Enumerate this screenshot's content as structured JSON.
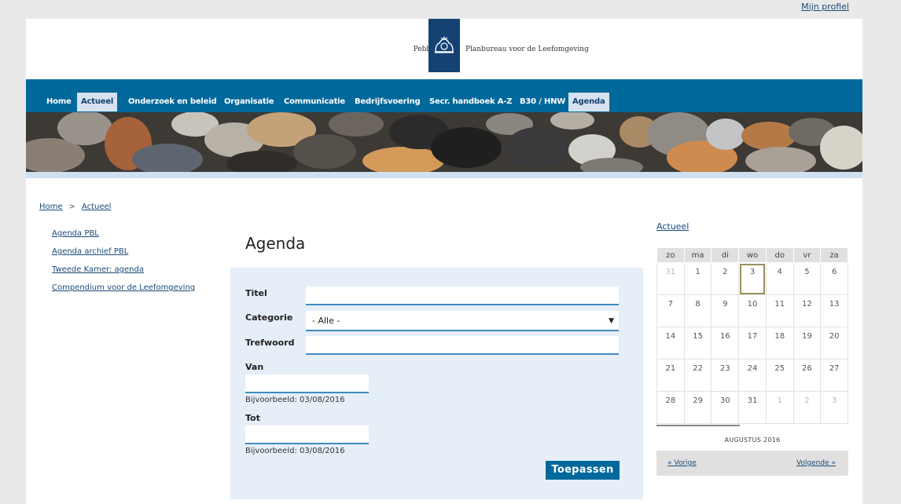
{
  "profile_link": "Mijn profiel",
  "logo": {
    "left_text": "Pebbles",
    "right_text": "Planbureau voor de Leefomgeving"
  },
  "nav": {
    "items": [
      {
        "label": "Home",
        "active": false
      },
      {
        "label": "Actueel",
        "active": true
      },
      {
        "label": "Onderzoek en beleid",
        "active": false
      },
      {
        "label": "Organisatie",
        "active": false
      },
      {
        "label": "Communicatie",
        "active": false
      },
      {
        "label": "Bedrijfsvoering",
        "active": false
      },
      {
        "label": "Secr. handboek A-Z",
        "active": false
      },
      {
        "label": "B30 / HNW",
        "active": false
      },
      {
        "label": "Agenda",
        "active": true
      }
    ]
  },
  "breadcrumb": {
    "home": "Home",
    "separator": ">",
    "current": "Actueel"
  },
  "sidebar": {
    "links": [
      "Agenda PBL",
      "Agenda archief PBL",
      "Tweede Kamer: agenda",
      "Compendium voor de Leefomgeving"
    ]
  },
  "main": {
    "title": "Agenda"
  },
  "form": {
    "titel_label": "Titel",
    "categorie_label": "Categorie",
    "categorie_value": "- Alle -",
    "trefwoord_label": "Trefwoord",
    "van_label": "Van",
    "van_hint": "Bijvoorbeeld: 03/08/2016",
    "tot_label": "Tot",
    "tot_hint": "Bijvoorbeeld: 03/08/2016",
    "apply_label": "Toepassen"
  },
  "calendar": {
    "link": "Actueel",
    "weekdays": [
      "zo",
      "ma",
      "di",
      "wo",
      "do",
      "vr",
      "za"
    ],
    "weeks": [
      [
        "31",
        "1",
        "2",
        "3",
        "4",
        "5",
        "6"
      ],
      [
        "7",
        "8",
        "9",
        "10",
        "11",
        "12",
        "13"
      ],
      [
        "14",
        "15",
        "16",
        "17",
        "18",
        "19",
        "20"
      ],
      [
        "21",
        "22",
        "23",
        "24",
        "25",
        "26",
        "27"
      ],
      [
        "28",
        "29",
        "30",
        "31",
        "1",
        "2",
        "3"
      ]
    ],
    "today": "3",
    "month_label": "AUGUSTUS 2016",
    "prev_label": "« Vorige",
    "next_label": "Volgende »"
  },
  "colors": {
    "nav_blue": "#01689b",
    "logo_blue": "#154273",
    "form_bg": "#e6eef8"
  }
}
